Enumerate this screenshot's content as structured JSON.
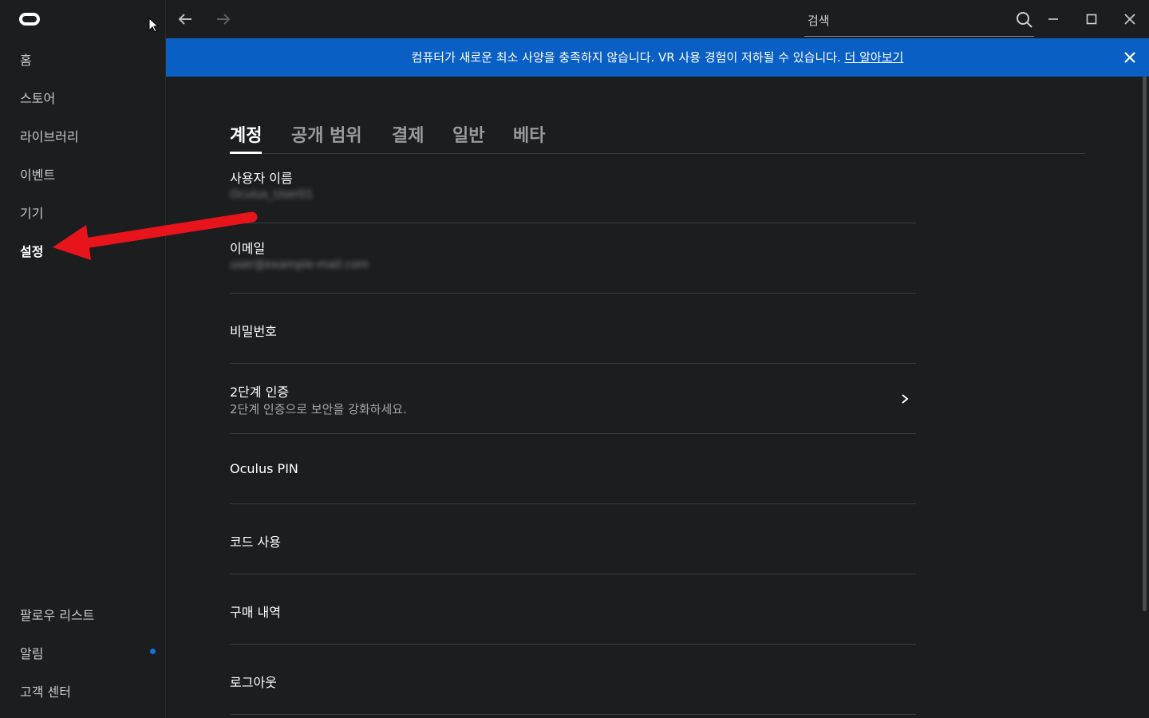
{
  "sidebar": {
    "items": [
      {
        "label": "홈"
      },
      {
        "label": "스토어"
      },
      {
        "label": "라이브러리"
      },
      {
        "label": "이벤트"
      },
      {
        "label": "기기"
      },
      {
        "label": "설정"
      }
    ],
    "bottom_items": [
      {
        "label": "팔로우 리스트"
      },
      {
        "label": "알림"
      },
      {
        "label": "고객 센터"
      }
    ]
  },
  "search": {
    "placeholder": "검색"
  },
  "banner": {
    "text": "컴퓨터가 새로운 최소 사양을 충족하지 않습니다. VR 사용 경험이 저하될 수 있습니다.",
    "link": "더 알아보기"
  },
  "tabs": [
    {
      "label": "계정"
    },
    {
      "label": "공개 범위"
    },
    {
      "label": "결제"
    },
    {
      "label": "일반"
    },
    {
      "label": "베타"
    }
  ],
  "rows": {
    "username": {
      "title": "사용자 이름",
      "value": "Oculus_User01"
    },
    "email": {
      "title": "이메일",
      "value": "user@example-mail.com"
    },
    "password": {
      "title": "비밀번호"
    },
    "twofactor": {
      "title": "2단계 인증",
      "subtitle": "2단계 인증으로 보안을 강화하세요."
    },
    "pin": {
      "title": "Oculus PIN"
    },
    "redeem": {
      "title": "코드 사용"
    },
    "purchases": {
      "title": "구매 내역"
    },
    "logout": {
      "title": "로그아웃"
    }
  },
  "colors": {
    "banner": "#0a5fc4",
    "annotation_arrow": "#e8141b",
    "notification_dot": "#1a6fd8"
  }
}
